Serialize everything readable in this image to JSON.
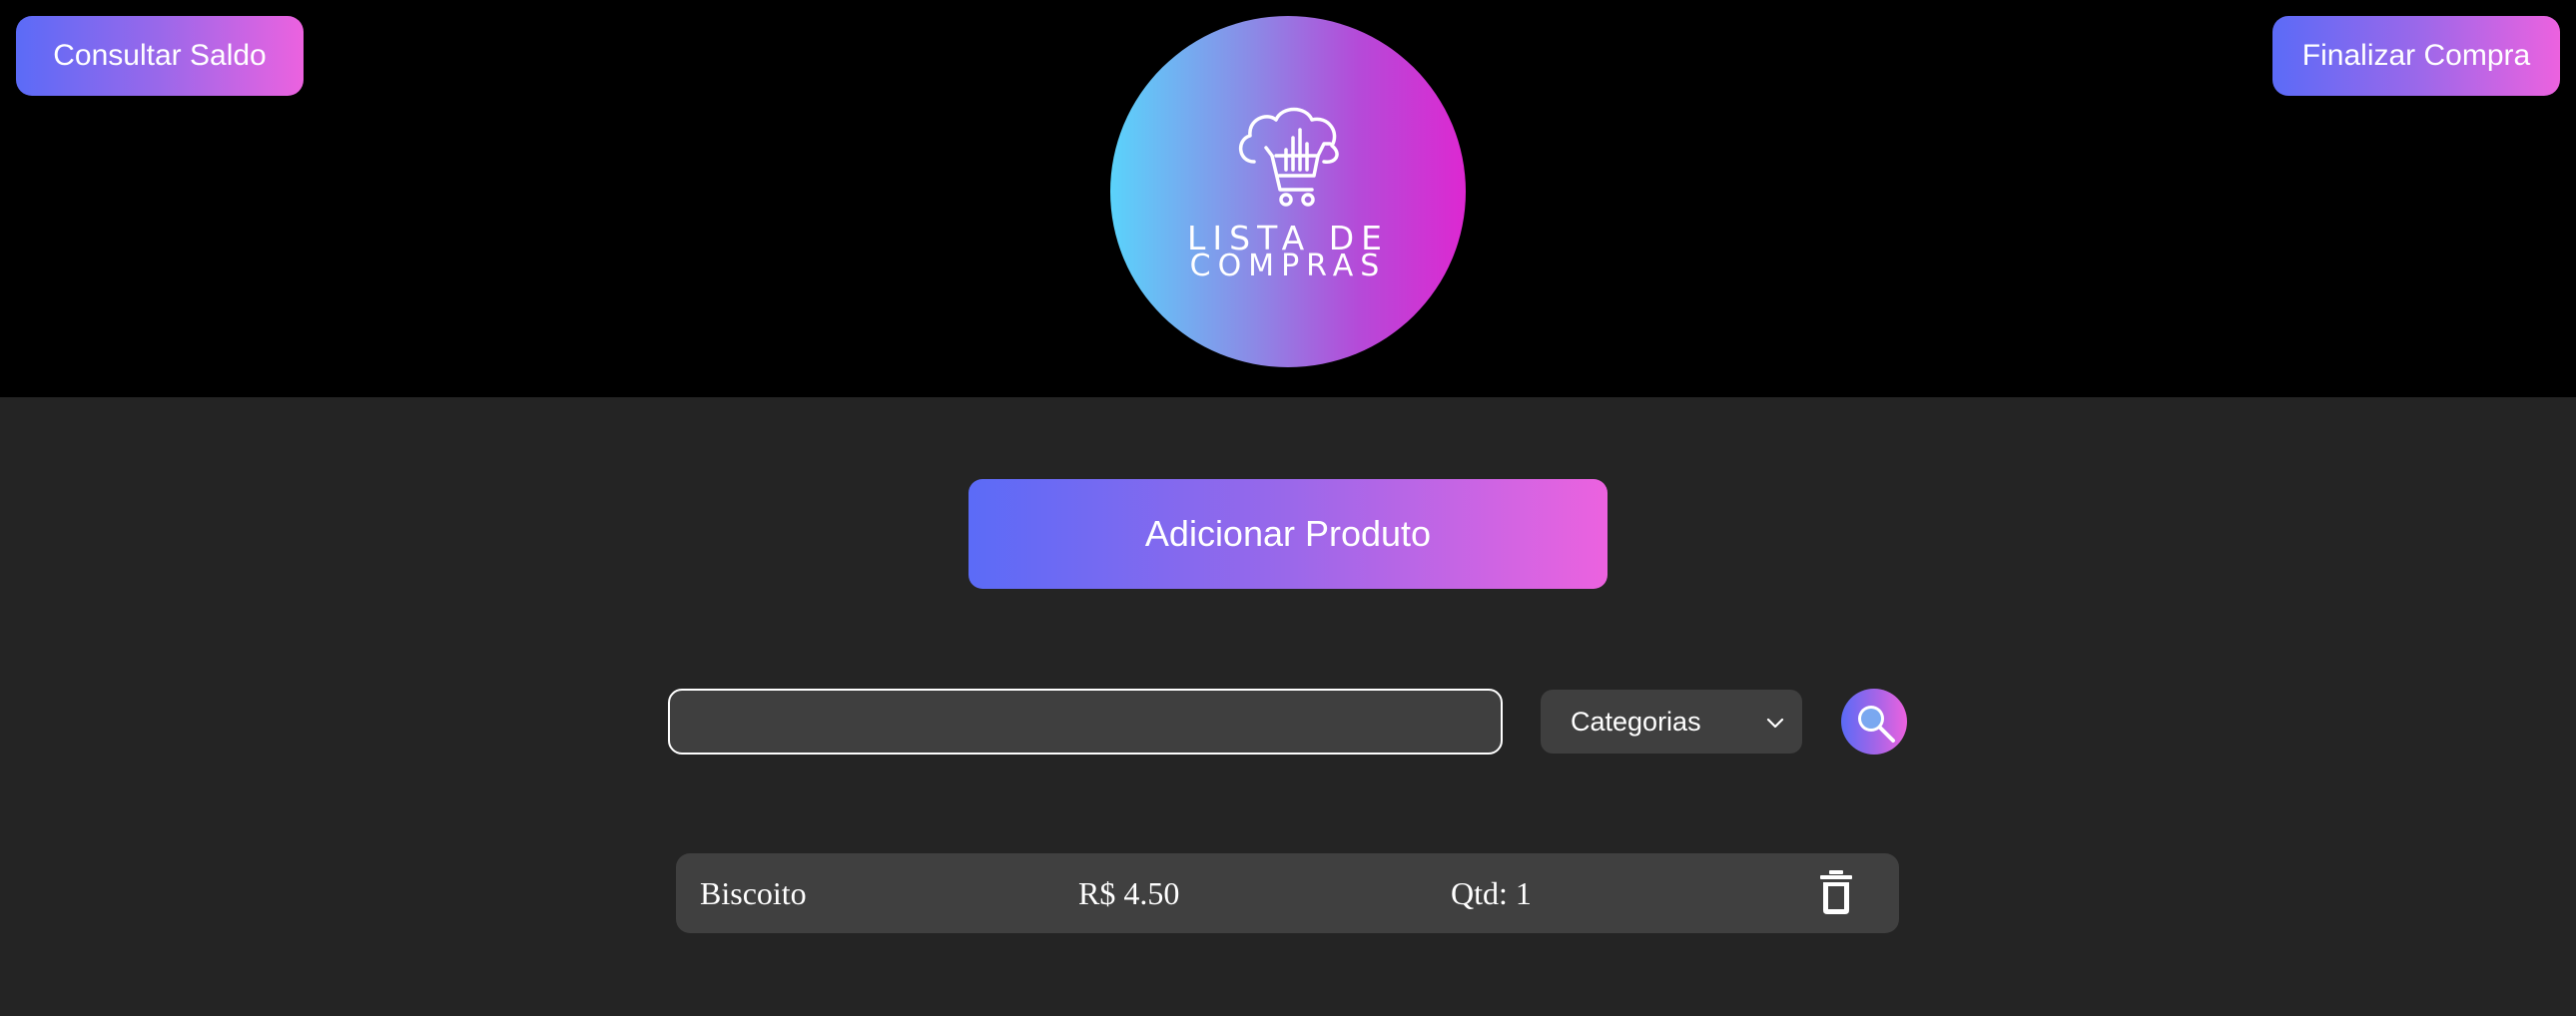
{
  "header": {
    "saldo_button_label": "Consultar Saldo",
    "finalizar_button_label": "Finalizar Compra",
    "logo": {
      "line1": "LISTA DE",
      "line2": "COMPRAS",
      "icon": "cloud-cart-icon"
    }
  },
  "main": {
    "add_button_label": "Adicionar Produto",
    "search": {
      "value": "",
      "placeholder": ""
    },
    "category_select": {
      "selected": "Categorias",
      "icon": "chevron-down-icon"
    },
    "search_button_icon": "search-icon",
    "items": [
      {
        "name": "Biscoito",
        "price": "R$ 4.50",
        "qty_label": "Qtd:",
        "qty": "1",
        "delete_icon": "trash-icon"
      }
    ]
  },
  "colors": {
    "header_bg": "#000000",
    "page_bg": "#242424",
    "gradient_start": "#5b6bf7",
    "gradient_end": "#ec62df",
    "logo_gradient_start": "#5ad3fb",
    "logo_gradient_end": "#dd28d1",
    "row_bg": "#404040"
  }
}
